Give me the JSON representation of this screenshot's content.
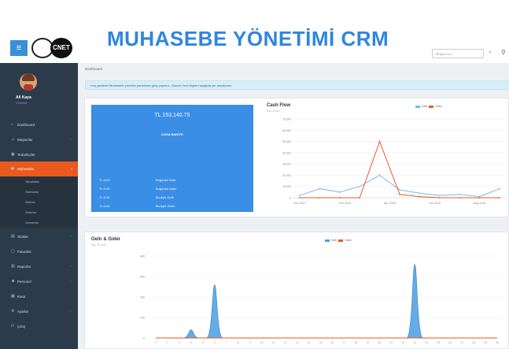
{
  "header": {
    "app_title": "MUHASEBE YÖNETİMİ CRM",
    "logo_text": "CNET",
    "search_placeholder": "Müşteri Ara..."
  },
  "sidebar": {
    "user_name": "Ali Kaya",
    "user_role": "Yönetici",
    "items": [
      {
        "label": "Dashboard",
        "icon": "home-icon"
      },
      {
        "label": "Müşteriler",
        "icon": "users-icon"
      },
      {
        "label": "Tedarikçiler",
        "icon": "truck-icon"
      },
      {
        "label": "Muhasebe",
        "icon": "money-icon",
        "active": true
      },
      {
        "label": "Stoklar",
        "icon": "box-icon"
      },
      {
        "label": "Faturalar",
        "icon": "file-icon"
      },
      {
        "label": "Raporlar",
        "icon": "chart-icon"
      },
      {
        "label": "Personel",
        "icon": "user-icon"
      },
      {
        "label": "Kasa",
        "icon": "cash-icon"
      },
      {
        "label": "Ayarlar",
        "icon": "gear-icon"
      },
      {
        "label": "Çıkış",
        "icon": "logout-icon"
      }
    ],
    "sub_items": [
      "Tahsilatlar",
      "Ödemeler",
      "Gelirler",
      "Giderler",
      "Virmanlar"
    ]
  },
  "main": {
    "breadcrumb": "Dashboard",
    "alert": "Hoş geldiniz! Muhasebe yönetim panelinize giriş yaptınız. Güncel özet bilgileri aşağıda yer almaktadır."
  },
  "balance": {
    "amount": "TL 153,140.75",
    "label": "KASA BAKİYE",
    "rows": [
      {
        "value": "TL 0.00",
        "label": "Bugünkü Gelir"
      },
      {
        "value": "TL 0.00",
        "label": "Bugünkü Gider"
      },
      {
        "value": "TL 0.00",
        "label": "Bu Ayki Gelir"
      },
      {
        "value": "TL 0.00",
        "label": "Bu Ayki Gider"
      }
    ]
  },
  "colors": {
    "accent": "#3a8ee6",
    "income": "#4a9de2",
    "expense": "#ea5a1f",
    "sidebar": "#2c3b49"
  },
  "chart_data": [
    {
      "type": "line",
      "title": "Cash Flow",
      "subtitle": "Son 12 Ay",
      "legend": [
        "Gelir",
        "Gider"
      ],
      "y_ticks": [
        "70,000",
        "60,000",
        "50,000",
        "40,000",
        "30,000",
        "20,000",
        "10,000",
        "0"
      ],
      "x_ticks": [
        "Dec 2017",
        "Feb 2018",
        "Apr 2018",
        "Jun 2018",
        "Aug 2018"
      ],
      "ylim": [
        0,
        70000
      ],
      "x_count": 11,
      "series": [
        {
          "name": "Gelir",
          "color": "#7fb7e8",
          "values": [
            2000,
            8000,
            5000,
            10000,
            20000,
            7000,
            4000,
            2000,
            3000,
            1000,
            8000
          ]
        },
        {
          "name": "Gider",
          "color": "#ea5a1f",
          "values": [
            0,
            0,
            0,
            0,
            50000,
            3000,
            1000,
            0,
            0,
            0,
            0
          ]
        }
      ]
    },
    {
      "type": "area",
      "title": "Gelir & Gider",
      "subtitle": "Son 30 Gün",
      "legend": [
        "Gelir",
        "Gider"
      ],
      "y_ticks": [
        "400",
        "300",
        "200",
        "100",
        "0"
      ],
      "ylim": [
        0,
        400
      ],
      "x_ticks": [
        "1",
        "2",
        "3",
        "4",
        "5",
        "6",
        "7",
        "8",
        "9",
        "10",
        "11",
        "12",
        "13",
        "14",
        "15",
        "16",
        "17",
        "18",
        "19",
        "20",
        "21",
        "22",
        "23",
        "24",
        "25",
        "26",
        "27",
        "28",
        "29",
        "30"
      ],
      "series": [
        {
          "name": "Gelir",
          "color": "#4a9de2",
          "values": [
            0,
            0,
            0,
            40,
            0,
            260,
            0,
            0,
            0,
            0,
            0,
            0,
            0,
            0,
            0,
            0,
            0,
            0,
            0,
            0,
            0,
            0,
            360,
            0,
            0,
            0,
            0,
            0,
            0,
            0
          ]
        },
        {
          "name": "Gider",
          "color": "#ea5a1f",
          "values": [
            0,
            0,
            0,
            0,
            0,
            0,
            0,
            0,
            0,
            0,
            0,
            0,
            0,
            0,
            0,
            0,
            0,
            0,
            0,
            0,
            0,
            0,
            0,
            0,
            0,
            0,
            0,
            0,
            0,
            0
          ]
        }
      ]
    }
  ]
}
